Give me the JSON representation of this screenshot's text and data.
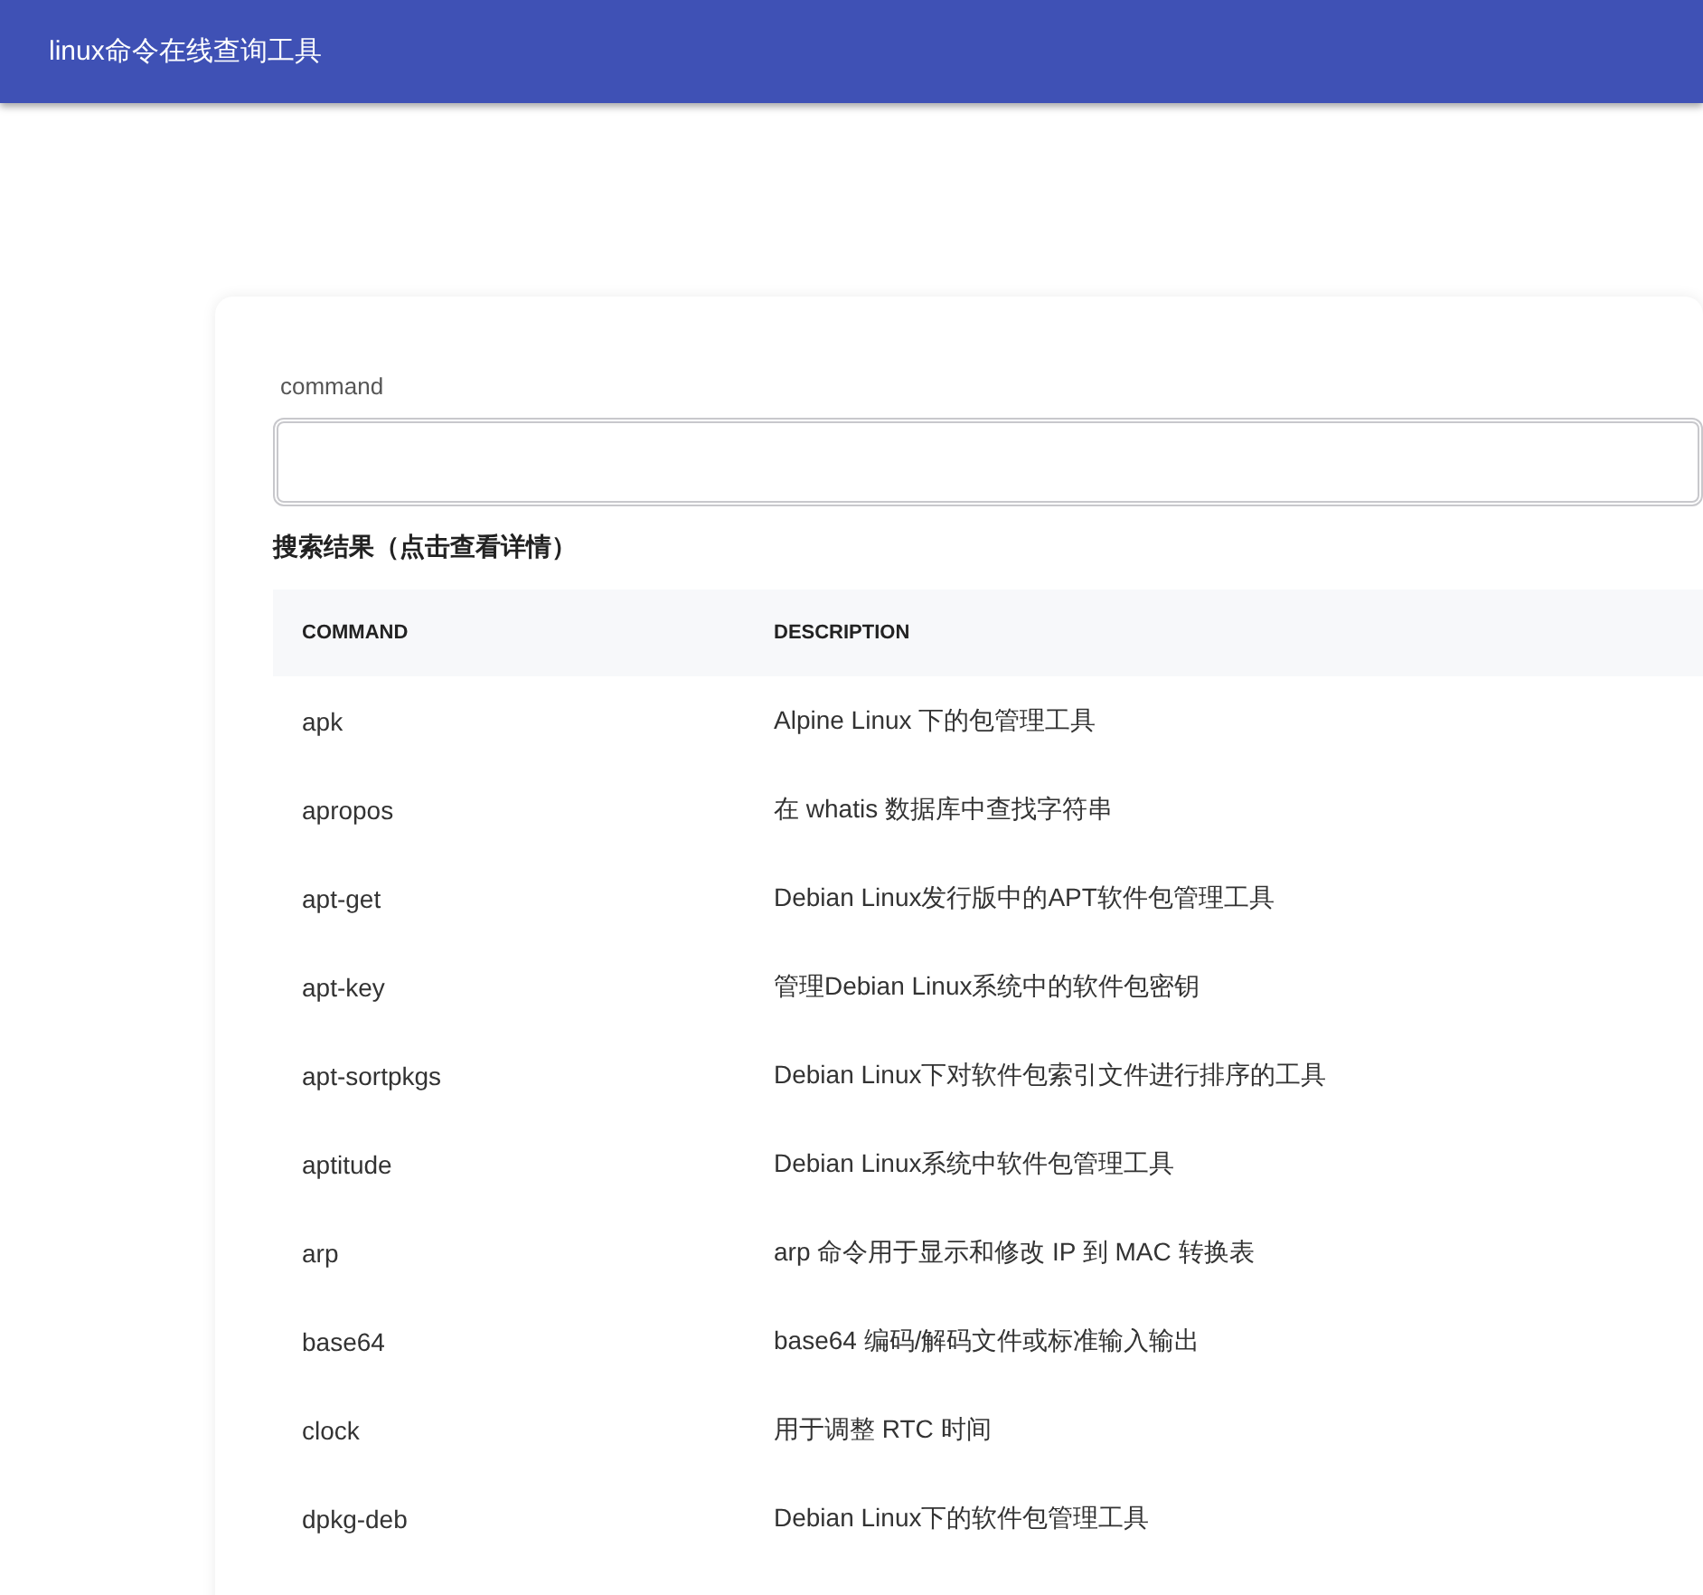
{
  "app_bar": {
    "title": "linux命令在线查询工具"
  },
  "search": {
    "label": "command"
  },
  "results": {
    "heading": "搜索结果（点击查看详情）",
    "columns": [
      "COMMAND",
      "DESCRIPTION"
    ],
    "rows": [
      {
        "command": "apk",
        "description": "Alpine Linux 下的包管理工具"
      },
      {
        "command": "apropos",
        "description": "在 whatis 数据库中查找字符串"
      },
      {
        "command": "apt-get",
        "description": "Debian Linux发行版中的APT软件包管理工具"
      },
      {
        "command": "apt-key",
        "description": "管理Debian Linux系统中的软件包密钥"
      },
      {
        "command": "apt-sortpkgs",
        "description": "Debian Linux下对软件包索引文件进行排序的工具"
      },
      {
        "command": "aptitude",
        "description": "Debian Linux系统中软件包管理工具"
      },
      {
        "command": "arp",
        "description": "arp 命令用于显示和修改 IP 到 MAC 转换表"
      },
      {
        "command": "base64",
        "description": "base64 编码/解码文件或标准输入输出"
      },
      {
        "command": "clock",
        "description": "用于调整 RTC 时间"
      },
      {
        "command": "dpkg-deb",
        "description": "Debian Linux下的软件包管理工具"
      }
    ]
  }
}
